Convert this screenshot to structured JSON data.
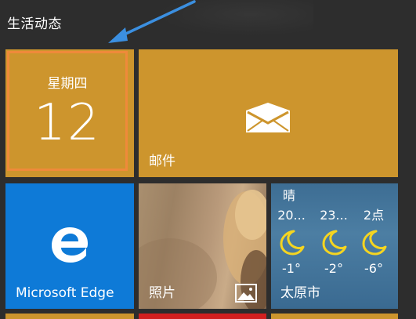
{
  "group": {
    "title": "生活动态"
  },
  "tiles": {
    "calendar": {
      "weekday": "星期四",
      "day": "12",
      "color": "#cd952d",
      "selected_border": "#ef8a3a"
    },
    "mail": {
      "label": "邮件",
      "icon": "mail-icon",
      "color": "#cd952d"
    },
    "edge": {
      "label": "Microsoft Edge",
      "icon": "edge-logo-icon",
      "color": "#0e7ad7"
    },
    "photos": {
      "label": "照片",
      "icon": "photo-icon"
    },
    "weather": {
      "condition": "晴",
      "city": "太原市",
      "forecast": [
        {
          "time": "20...",
          "temp": "-1°",
          "icon": "moon-icon"
        },
        {
          "time": "23...",
          "temp": "-2°",
          "icon": "moon-icon"
        },
        {
          "time": "2点",
          "temp": "-6°",
          "icon": "moon-icon"
        }
      ]
    }
  },
  "annotation": {
    "arrow_color": "#3b8fe0"
  }
}
